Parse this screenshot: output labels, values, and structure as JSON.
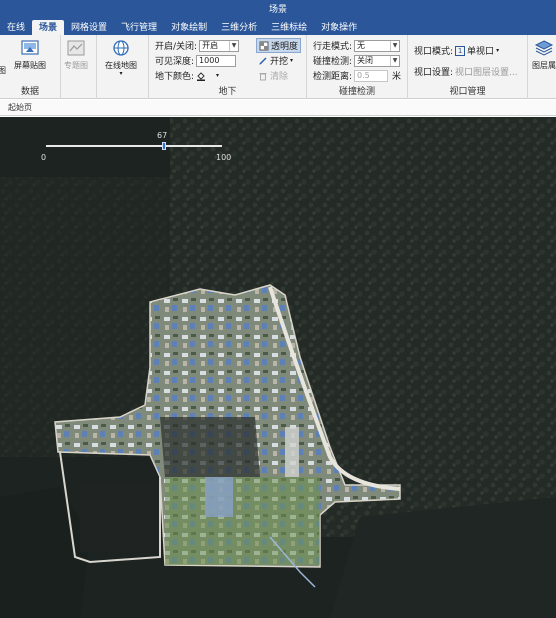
{
  "app": {
    "title": "场景"
  },
  "tabs": [
    {
      "label": "在线",
      "active": false
    },
    {
      "label": "场景",
      "active": true
    },
    {
      "label": "网格设置",
      "active": false
    },
    {
      "label": "飞行管理",
      "active": false
    },
    {
      "label": "对象绘制",
      "active": false
    },
    {
      "label": "三维分析",
      "active": false
    },
    {
      "label": "三维标绘",
      "active": false
    },
    {
      "label": "对象操作",
      "active": false
    }
  ],
  "ribbon": {
    "data_group": {
      "label": "数据",
      "partial_label": "图",
      "screenshot_label": "屏幕贴图",
      "thematic_label": "专题图",
      "online_map_label": "在线地图"
    },
    "underground_group": {
      "label": "地下",
      "toggle_label": "开启/关闭:",
      "toggle_value": "开启",
      "depth_label": "可见深度:",
      "depth_value": "1000",
      "color_label": "地下颜色:",
      "transparency_label": "透明度",
      "excavate_label": "开挖",
      "clear_label": "清除"
    },
    "collision_group": {
      "label": "碰撞检测",
      "mode_label": "行走模式:",
      "mode_value": "无",
      "detect_label": "碰撞检测:",
      "detect_value": "关闭",
      "distance_label": "检测距离:",
      "distance_value": "0.5",
      "distance_unit": "米"
    },
    "viewport_group": {
      "label": "视口管理",
      "mode_label": "视口模式:",
      "mode_value": "单视口",
      "mode_badge": "1",
      "settings_label": "视口设置:",
      "settings_value": "视口图层设置..."
    },
    "layer_group": {
      "partial_label": "图层属"
    }
  },
  "doc_tab": {
    "label": "起始页"
  },
  "map": {
    "slider": {
      "value": 67,
      "fraction": 0.67,
      "min": "0",
      "max": "100",
      "value_label": "67"
    }
  }
}
